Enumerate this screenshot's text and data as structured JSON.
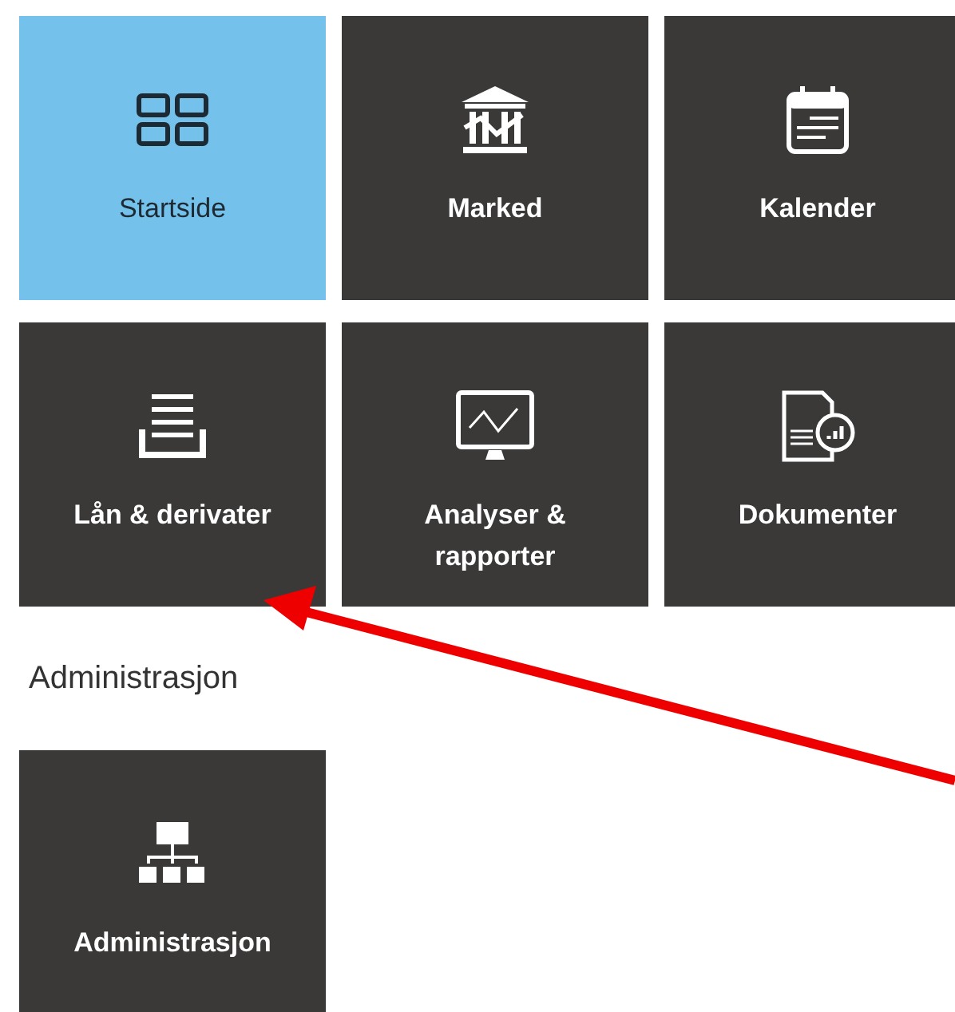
{
  "tiles": [
    {
      "kind": "home",
      "label": "Startside",
      "selected": true
    },
    {
      "kind": "market",
      "label": "Marked",
      "selected": false
    },
    {
      "kind": "calendar",
      "label": "Kalender",
      "selected": false
    },
    {
      "kind": "loans",
      "label": "Lån & derivater",
      "selected": false
    },
    {
      "kind": "analysis",
      "label": "Analyser & rapporter",
      "selected": false
    },
    {
      "kind": "documents",
      "label": "Dokumenter",
      "selected": false
    }
  ],
  "admin_section": {
    "heading": "Administrasjon",
    "tiles": [
      {
        "kind": "admin",
        "label": "Administrasjon",
        "selected": false
      }
    ]
  }
}
